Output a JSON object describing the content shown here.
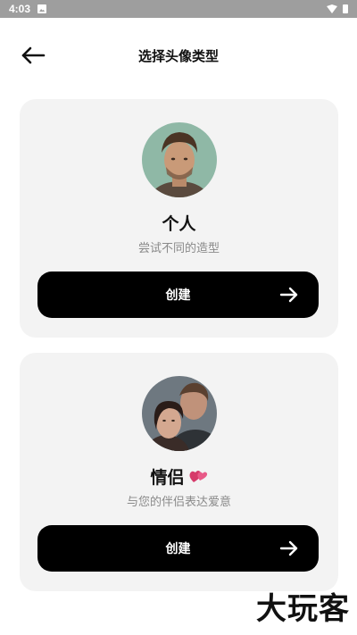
{
  "status_bar": {
    "time": "4:03"
  },
  "header": {
    "title": "选择头像类型"
  },
  "cards": [
    {
      "title": "个人",
      "subtitle": "尝试不同的造型",
      "button_label": "创建"
    },
    {
      "title": "情侣",
      "subtitle": "与您的伴侣表达爱意",
      "button_label": "创建"
    }
  ],
  "watermark": "大玩客",
  "colors": {
    "card_bg": "#f3f3f3",
    "button_bg": "#000000",
    "subtitle": "#8a8a8a",
    "status_bar": "#9e9e9e"
  },
  "icons": [
    "back-arrow-icon",
    "arrow-right-icon",
    "heart-icon",
    "wifi-icon",
    "battery-icon",
    "photo-icon"
  ]
}
